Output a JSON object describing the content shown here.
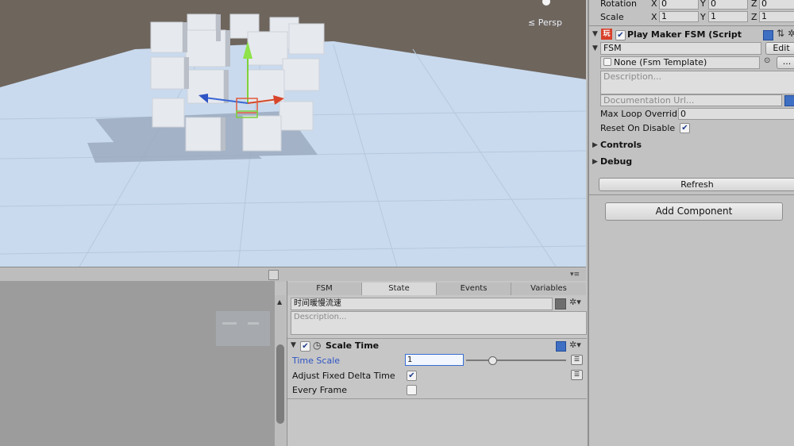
{
  "scene": {
    "persp_label": "≤ Persp"
  },
  "inspector": {
    "rotation_label": "Rotation",
    "scale_label": "Scale",
    "rotation": {
      "x_label": "X",
      "x": "0",
      "y_label": "Y",
      "y": "0",
      "z_label": "Z",
      "z": "0"
    },
    "scale": {
      "x_label": "X",
      "x": "1",
      "y_label": "Y",
      "y": "1",
      "z_label": "Z",
      "z": "1"
    },
    "component_title": "Play Maker FSM (Script",
    "fsm_name": "FSM",
    "edit_label": "Edit",
    "template_value": "None (Fsm Template)",
    "dots_label": "...",
    "description_placeholder": "Description...",
    "doc_url_placeholder": "Documentation Url...",
    "max_loop_label": "Max Loop Overrid",
    "max_loop_value": "0",
    "reset_on_disable_label": "Reset On Disable",
    "controls_label": "Controls",
    "debug_label": "Debug",
    "refresh_label": "Refresh",
    "add_component_label": "Add Component"
  },
  "playmaker": {
    "tabs": [
      "FSM",
      "State",
      "Events",
      "Variables"
    ],
    "active_tab": "State",
    "state_name": "时间暖慢流速",
    "state_description_placeholder": "Description...",
    "action_title": "Scale Time",
    "rows": [
      {
        "label": "Time Scale",
        "value": "1"
      },
      {
        "label": "Adjust Fixed Delta Time"
      },
      {
        "label": "Every Frame"
      }
    ]
  },
  "colors": {
    "scene_ground": "#c8d9ef",
    "scene_sky": "#6e655d",
    "accent_blue": "#2f55c4"
  }
}
